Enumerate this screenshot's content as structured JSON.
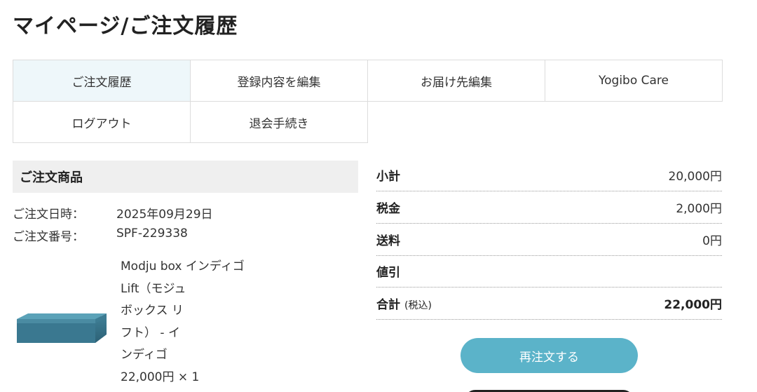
{
  "page_title": "マイページ/ご注文履歴",
  "tabs": [
    {
      "label": "ご注文履歴",
      "active": true
    },
    {
      "label": "登録内容を編集",
      "active": false
    },
    {
      "label": "お届け先編集",
      "active": false
    },
    {
      "label": "Yogibo Care",
      "active": false
    },
    {
      "label": "ログアウト",
      "active": false
    },
    {
      "label": "退会手続き",
      "active": false
    }
  ],
  "order": {
    "section_title": "ご注文商品",
    "date_label": "ご注文日時：",
    "date_value": "2025年09月29日",
    "number_label": "ご注文番号：",
    "number_value": "SPF-229338",
    "product": {
      "name_lines": [
        "Modju box インディゴ",
        "Lift（モジュ",
        "ボックス リ",
        "フト） - イ",
        "ンディゴ"
      ],
      "price_qty": "22,000円 × 1",
      "image_color": "#3f7f96"
    }
  },
  "summary": {
    "subtotal_label": "小計",
    "subtotal_value": "20,000円",
    "tax_label": "税金",
    "tax_value": "2,000円",
    "shipping_label": "送料",
    "shipping_value": "0円",
    "discount_label": "値引",
    "discount_value": "",
    "total_label": "合計",
    "total_note": "(税込)",
    "total_value": "22,000円"
  },
  "reorder_label": "再注文する",
  "colors": {
    "accent": "#5bb3c9",
    "active_tab_bg": "#eef7fa",
    "section_bg": "#efefef"
  }
}
